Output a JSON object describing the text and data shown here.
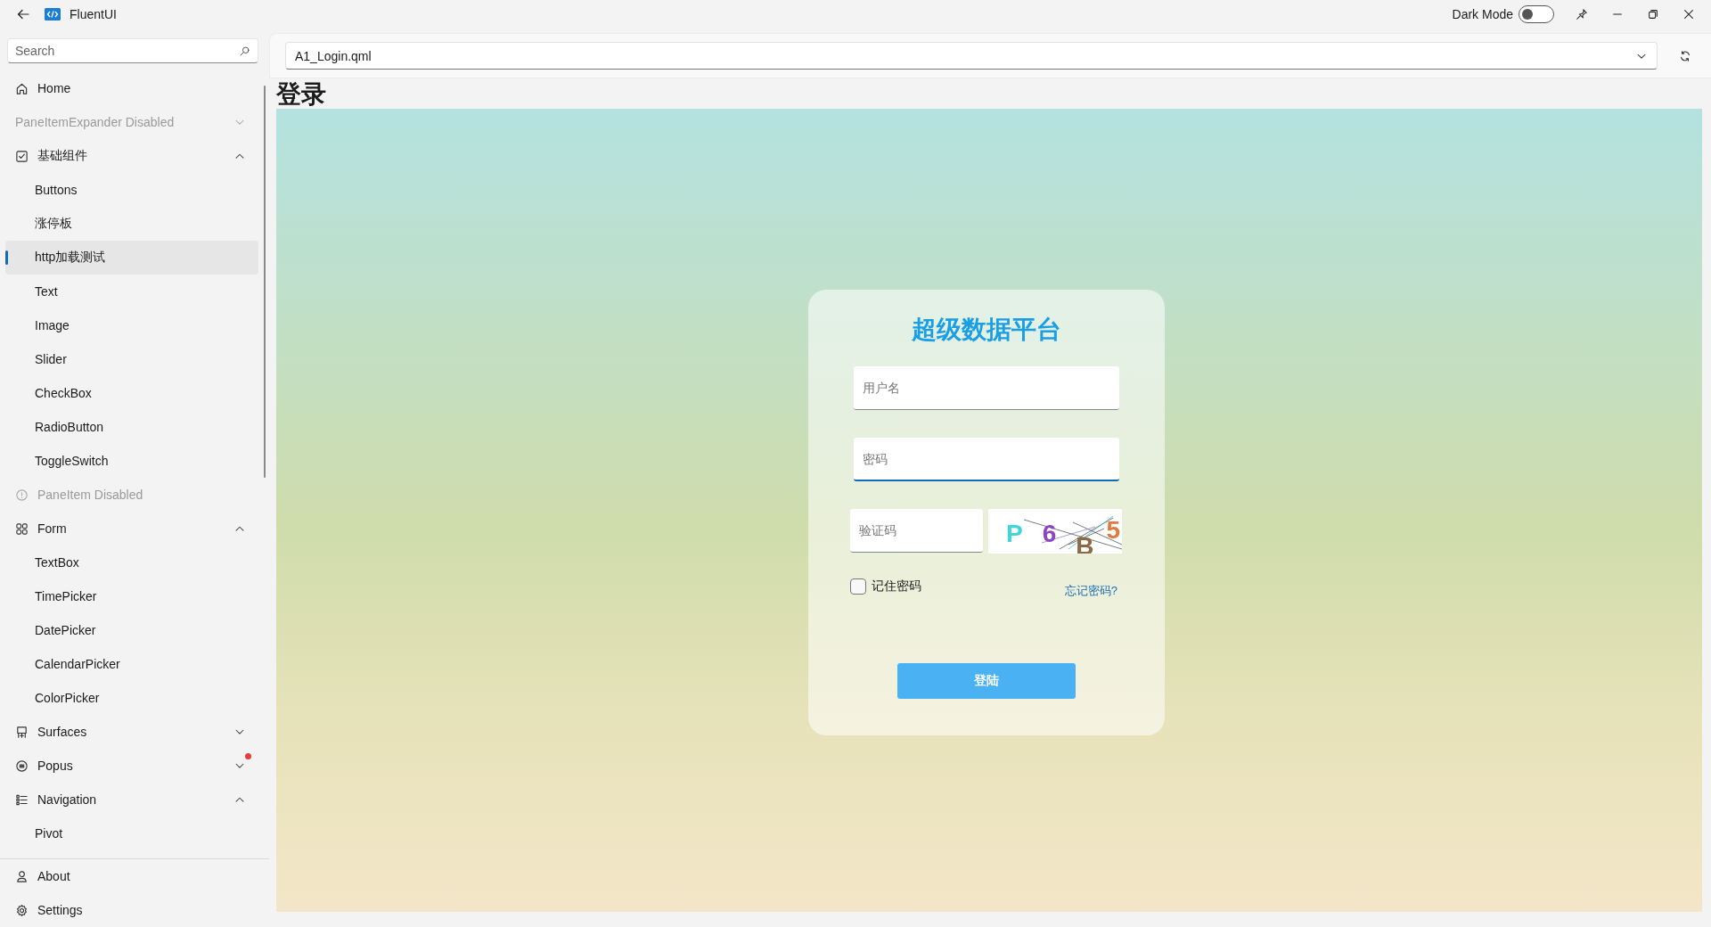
{
  "window": {
    "title": "FluentUI",
    "dark_mode": {
      "label": "Dark Mode",
      "on": false
    }
  },
  "sidebar": {
    "search": {
      "placeholder": "Search"
    },
    "items": [
      {
        "label": "Home",
        "disabled": false,
        "selected": false
      },
      {
        "label": "PaneItemExpander Disabled",
        "disabled": true,
        "expanded": false,
        "selected": false
      },
      {
        "label": "基础组件",
        "disabled": false,
        "expanded": true,
        "selected": false,
        "children": [
          {
            "label": "Buttons",
            "disabled": false,
            "selected": false
          },
          {
            "label": "涨停板",
            "disabled": false,
            "selected": false
          },
          {
            "label": "http加载测试",
            "disabled": false,
            "selected": true
          },
          {
            "label": "Text",
            "disabled": false,
            "selected": false
          },
          {
            "label": "Image",
            "disabled": false,
            "selected": false
          },
          {
            "label": "Slider",
            "disabled": false,
            "selected": false
          },
          {
            "label": "CheckBox",
            "disabled": false,
            "selected": false
          },
          {
            "label": "RadioButton",
            "disabled": false,
            "selected": false
          },
          {
            "label": "ToggleSwitch",
            "disabled": false,
            "selected": false
          }
        ]
      },
      {
        "label": "PaneItem Disabled",
        "disabled": true,
        "selected": false
      },
      {
        "label": "Form",
        "disabled": false,
        "expanded": true,
        "selected": false,
        "children": [
          {
            "label": "TextBox",
            "disabled": false,
            "selected": false
          },
          {
            "label": "TimePicker",
            "disabled": false,
            "selected": false
          },
          {
            "label": "DatePicker",
            "disabled": false,
            "selected": false
          },
          {
            "label": "CalendarPicker",
            "disabled": false,
            "selected": false
          },
          {
            "label": "ColorPicker",
            "disabled": false,
            "selected": false
          }
        ]
      },
      {
        "label": "Surfaces",
        "disabled": false,
        "expanded": false,
        "selected": false
      },
      {
        "label": "Popus",
        "disabled": false,
        "expanded": false,
        "selected": false,
        "badge": true
      },
      {
        "label": "Navigation",
        "disabled": false,
        "expanded": true,
        "selected": false,
        "children": [
          {
            "label": "Pivot",
            "disabled": false,
            "selected": false
          }
        ]
      }
    ],
    "footer_items": [
      {
        "label": "About",
        "selected": false
      },
      {
        "label": "Settings",
        "selected": false
      }
    ]
  },
  "toolbar": {
    "file_select": {
      "value": "A1_Login.qml"
    }
  },
  "page": {
    "heading": "登录",
    "login": {
      "title": "超级数据平台",
      "username": {
        "placeholder": "用户名",
        "focused": false
      },
      "password": {
        "placeholder": "密码",
        "focused": true
      },
      "captcha_input": {
        "placeholder": "验证码",
        "focused": false
      },
      "captcha": [
        {
          "text": "P",
          "color": "#3fd6d8"
        },
        {
          "text": "6",
          "color": "#8e44c0"
        },
        {
          "text": "B",
          "color": "#8b6a45"
        },
        {
          "text": "5",
          "color": "#e07a40"
        }
      ],
      "remember": {
        "label": "记住密码",
        "checked": false
      },
      "forgot_link": "忘记密码?",
      "submit": "登陆"
    }
  }
}
